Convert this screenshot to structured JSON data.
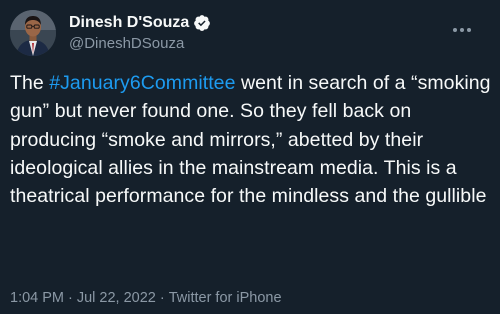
{
  "tweet": {
    "author": {
      "display_name": "Dinesh D'Souza",
      "handle": "@DineshDSouza",
      "verified": true,
      "avatar_icon": "user-avatar-photo"
    },
    "more_icon": "more-horizontal-icon",
    "text": {
      "prefix": "The ",
      "hashtag": "#January6Committee",
      "body": " went in search of a “smoking gun” but never found one. So they fell back on producing “smoke and mirrors,” abetted by their ideological allies in the mainstream media. This is a theatrical performance for the mindless and the gullible"
    },
    "meta": {
      "time": "1:04 PM",
      "separator1": "·",
      "date": "Jul 22, 2022",
      "separator2": "·",
      "source": "Twitter for iPhone"
    }
  },
  "colors": {
    "background": "#15202b",
    "text_primary": "#f7f9f9",
    "text_secondary": "#8b98a5",
    "accent": "#1d9bf0"
  }
}
